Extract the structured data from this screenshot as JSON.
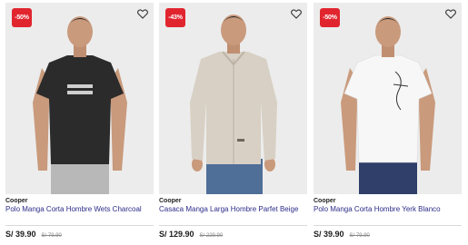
{
  "products": [
    {
      "badge": "-50%",
      "brand": "Cooper",
      "name": "Polo Manga Corta Hombre Wets Charcoal",
      "price": "S/ 39.90",
      "old_price": "S/ 79.90",
      "fav_icon": "heart-outline-icon",
      "garment_color": "#2b2b2b"
    },
    {
      "badge": "-43%",
      "brand": "Cooper",
      "name": "Casaca Manga Larga Hombre Parfet Beige",
      "price": "S/ 129.90",
      "old_price": "S/ 229.90",
      "fav_icon": "heart-outline-icon",
      "garment_color": "#d8d0c4"
    },
    {
      "badge": "-50%",
      "brand": "Cooper",
      "name": "Polo Manga Corta Hombre Yerk Blanco",
      "price": "S/ 39.90",
      "old_price": "S/ 79.90",
      "fav_icon": "heart-outline-icon",
      "garment_color": "#f7f7f7"
    }
  ],
  "colors": {
    "badge": "#e1252f",
    "product_name": "#2c2c8a",
    "photo_background": "#ececec"
  }
}
